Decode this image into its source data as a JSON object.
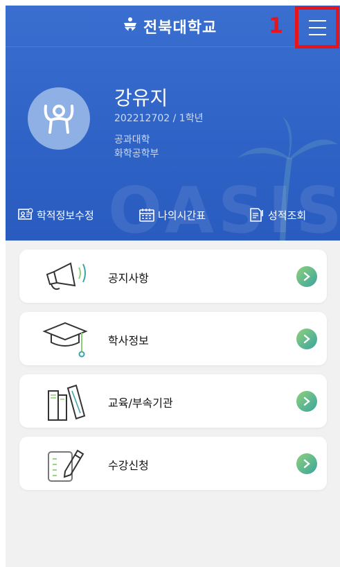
{
  "header": {
    "university_name": "전북대학교",
    "annotation_number": "1"
  },
  "profile": {
    "name": "강유지",
    "student_id_year": "202212702 / 1학년",
    "college": "공과대학",
    "department": "화학공학부"
  },
  "watermark": "OASIS",
  "quick_menu": [
    {
      "label": "학적정보수정",
      "icon": "id-card-icon"
    },
    {
      "label": "나의시간표",
      "icon": "calendar-icon"
    },
    {
      "label": "성적조회",
      "icon": "grade-report-icon"
    }
  ],
  "cards": [
    {
      "label": "공지사항",
      "icon": "megaphone-icon"
    },
    {
      "label": "학사정보",
      "icon": "graduation-cap-icon"
    },
    {
      "label": "교육/부속기관",
      "icon": "books-icon"
    },
    {
      "label": "수강신청",
      "icon": "document-pencil-icon"
    }
  ],
  "colors": {
    "header_blue": "#2f63c6",
    "highlight_red": "#e8141b",
    "arrow_green": "#39a4a0"
  }
}
